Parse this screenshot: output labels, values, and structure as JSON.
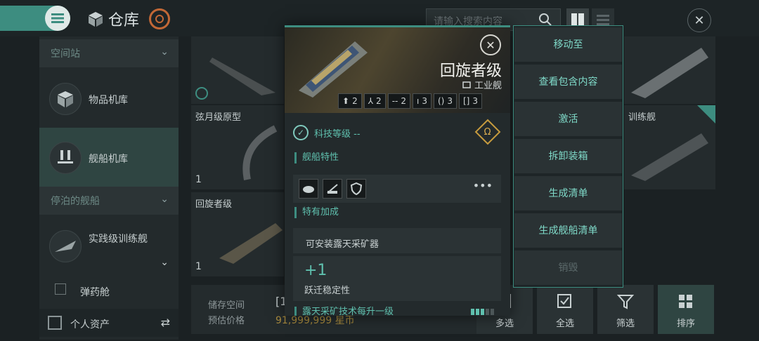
{
  "header": {
    "title": "仓库",
    "search_placeholder": "请输入搜索内容"
  },
  "sidebar": {
    "section_station": "空间站",
    "item_goods": "物品机库",
    "item_fleet": "舰船机库",
    "section_docked": "停泊的舰船",
    "docked_ship": "实践级训练舰",
    "item_ammo": "弹药舱",
    "personal_assets": "个人资产"
  },
  "grid": {
    "cell1_name": "弦月级原型",
    "cell1_count": "1",
    "cell2_name": "回旋者级",
    "cell2_count": "1",
    "cell3_name": "训练舰"
  },
  "storage": {
    "space_label": "储存空间",
    "price_label": "预估价格",
    "price_value": "91,999,999 星币",
    "space_value": "[1"
  },
  "bottom_buttons": {
    "multi": "多选",
    "all": "全选",
    "filter": "筛选",
    "sort": "排序"
  },
  "modal": {
    "ship_name": "回旋者级",
    "ship_class": "工业舰",
    "slots": [
      {
        "icon": "turret-hardpoint-icon",
        "value": "2"
      },
      {
        "icon": "launcher-hardpoint-icon",
        "value": "2"
      },
      {
        "icon": "high-slot-icon",
        "value": "2"
      },
      {
        "icon": "mid-slot-icon",
        "value": "3"
      },
      {
        "icon": "low-slot-icon",
        "value": "3"
      },
      {
        "icon": "rig-slot-icon",
        "value": "3"
      }
    ],
    "tech_level": "科技等级 --",
    "section_traits": "舰船特性",
    "section_bonus": "特有加成",
    "bonus_text": "可安装露天采矿器",
    "stability_value": "+1",
    "stability_label": "跃迁稳定性",
    "skill_text": "露天采矿技术每升一级"
  },
  "context_menu": {
    "move_to": "移动至",
    "view_contents": "查看包含内容",
    "activate": "激活",
    "unpack": "拆卸装箱",
    "make_list": "生成清单",
    "make_ship_list": "生成舰船清单",
    "destroy": "销毁"
  },
  "colors": {
    "accent": "#3d8d80",
    "accent_text": "#5fc0ae",
    "gold": "#c79b3e"
  }
}
